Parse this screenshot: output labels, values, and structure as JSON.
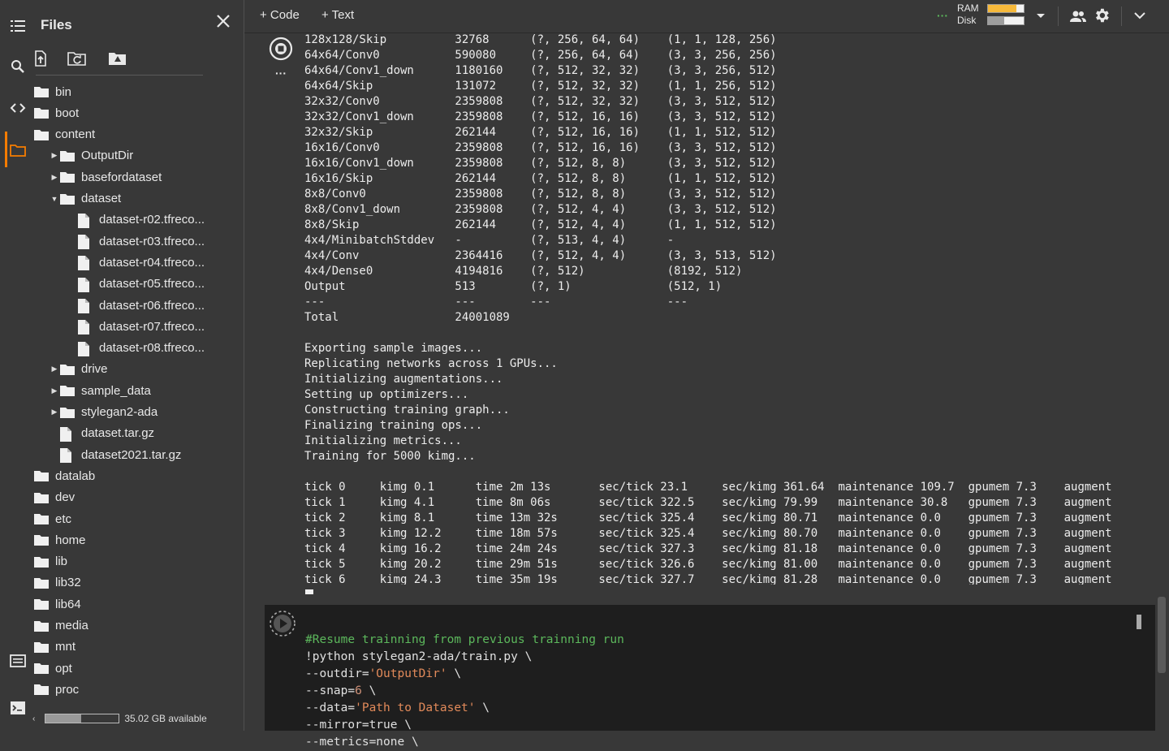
{
  "sidebar": {
    "title": "Files",
    "storage": "35.02 GB available",
    "tree": [
      {
        "label": "bin",
        "kind": "folder",
        "indent": 0,
        "arrow": ""
      },
      {
        "label": "boot",
        "kind": "folder",
        "indent": 0,
        "arrow": ""
      },
      {
        "label": "content",
        "kind": "folder",
        "indent": 0,
        "arrow": ""
      },
      {
        "label": "OutputDir",
        "kind": "folder",
        "indent": 1,
        "arrow": "right"
      },
      {
        "label": "basefordataset",
        "kind": "folder",
        "indent": 1,
        "arrow": "right"
      },
      {
        "label": "dataset",
        "kind": "folder",
        "indent": 1,
        "arrow": "down"
      },
      {
        "label": "dataset-r02.tfreco...",
        "kind": "file",
        "indent": 2,
        "arrow": ""
      },
      {
        "label": "dataset-r03.tfreco...",
        "kind": "file",
        "indent": 2,
        "arrow": ""
      },
      {
        "label": "dataset-r04.tfreco...",
        "kind": "file",
        "indent": 2,
        "arrow": ""
      },
      {
        "label": "dataset-r05.tfreco...",
        "kind": "file",
        "indent": 2,
        "arrow": ""
      },
      {
        "label": "dataset-r06.tfreco...",
        "kind": "file",
        "indent": 2,
        "arrow": ""
      },
      {
        "label": "dataset-r07.tfreco...",
        "kind": "file",
        "indent": 2,
        "arrow": ""
      },
      {
        "label": "dataset-r08.tfreco...",
        "kind": "file",
        "indent": 2,
        "arrow": ""
      },
      {
        "label": "drive",
        "kind": "folder",
        "indent": 1,
        "arrow": "right"
      },
      {
        "label": "sample_data",
        "kind": "folder",
        "indent": 1,
        "arrow": "right"
      },
      {
        "label": "stylegan2-ada",
        "kind": "folder",
        "indent": 1,
        "arrow": "right"
      },
      {
        "label": "dataset.tar.gz",
        "kind": "file",
        "indent": 1,
        "arrow": ""
      },
      {
        "label": "dataset2021.tar.gz",
        "kind": "file",
        "indent": 1,
        "arrow": ""
      },
      {
        "label": "datalab",
        "kind": "folder",
        "indent": 0,
        "arrow": ""
      },
      {
        "label": "dev",
        "kind": "folder",
        "indent": 0,
        "arrow": ""
      },
      {
        "label": "etc",
        "kind": "folder",
        "indent": 0,
        "arrow": ""
      },
      {
        "label": "home",
        "kind": "folder",
        "indent": 0,
        "arrow": ""
      },
      {
        "label": "lib",
        "kind": "folder",
        "indent": 0,
        "arrow": ""
      },
      {
        "label": "lib32",
        "kind": "folder",
        "indent": 0,
        "arrow": ""
      },
      {
        "label": "lib64",
        "kind": "folder",
        "indent": 0,
        "arrow": ""
      },
      {
        "label": "media",
        "kind": "folder",
        "indent": 0,
        "arrow": ""
      },
      {
        "label": "mnt",
        "kind": "folder",
        "indent": 0,
        "arrow": ""
      },
      {
        "label": "opt",
        "kind": "folder",
        "indent": 0,
        "arrow": ""
      },
      {
        "label": "proc",
        "kind": "folder",
        "indent": 0,
        "arrow": ""
      }
    ]
  },
  "toolbar": {
    "code_label": "+ Code",
    "text_label": "+ Text",
    "ram_label": "RAM",
    "disk_label": "Disk",
    "ram_fill": 0.8,
    "disk_fill": 0.45
  },
  "colors": {
    "accent": "#f57c00",
    "ram": "#f6b93b",
    "disk": "#9e9e9e",
    "comment": "#5cb85c",
    "string": "#e28a5a"
  },
  "output_lines": [
    "128x128/Skip          32768      (?, 256, 64, 64)    (1, 1, 128, 256)",
    "64x64/Conv0           590080     (?, 256, 64, 64)    (3, 3, 256, 256)",
    "64x64/Conv1_down      1180160    (?, 512, 32, 32)    (3, 3, 256, 512)",
    "64x64/Skip            131072     (?, 512, 32, 32)    (1, 1, 256, 512)",
    "32x32/Conv0           2359808    (?, 512, 32, 32)    (3, 3, 512, 512)",
    "32x32/Conv1_down      2359808    (?, 512, 16, 16)    (3, 3, 512, 512)",
    "32x32/Skip            262144     (?, 512, 16, 16)    (1, 1, 512, 512)",
    "16x16/Conv0           2359808    (?, 512, 16, 16)    (3, 3, 512, 512)",
    "16x16/Conv1_down      2359808    (?, 512, 8, 8)      (3, 3, 512, 512)",
    "16x16/Skip            262144     (?, 512, 8, 8)      (1, 1, 512, 512)",
    "8x8/Conv0             2359808    (?, 512, 8, 8)      (3, 3, 512, 512)",
    "8x8/Conv1_down        2359808    (?, 512, 4, 4)      (3, 3, 512, 512)",
    "8x8/Skip              262144     (?, 512, 4, 4)      (1, 1, 512, 512)",
    "4x4/MinibatchStddev   -          (?, 513, 4, 4)      -",
    "4x4/Conv              2364416    (?, 512, 4, 4)      (3, 3, 513, 512)",
    "4x4/Dense0            4194816    (?, 512)            (8192, 512)",
    "Output                513        (?, 1)              (512, 1)",
    "---                   ---        ---                 ---",
    "Total                 24001089",
    "",
    "Exporting sample images...",
    "Replicating networks across 1 GPUs...",
    "Initializing augmentations...",
    "Setting up optimizers...",
    "Constructing training graph...",
    "Finalizing training ops...",
    "Initializing metrics...",
    "Training for 5000 kimg...",
    "",
    "tick 0     kimg 0.1      time 2m 13s       sec/tick 23.1     sec/kimg 361.64  maintenance 109.7  gpumem 7.3    augment",
    "tick 1     kimg 4.1      time 8m 06s       sec/tick 322.5    sec/kimg 79.99   maintenance 30.8   gpumem 7.3    augment",
    "tick 2     kimg 8.1      time 13m 32s      sec/tick 325.4    sec/kimg 80.71   maintenance 0.0    gpumem 7.3    augment",
    "tick 3     kimg 12.2     time 18m 57s      sec/tick 325.4    sec/kimg 80.70   maintenance 0.0    gpumem 7.3    augment",
    "tick 4     kimg 16.2     time 24m 24s      sec/tick 327.3    sec/kimg 81.18   maintenance 0.0    gpumem 7.3    augment",
    "tick 5     kimg 20.2     time 29m 51s      sec/tick 326.6    sec/kimg 81.00   maintenance 0.0    gpumem 7.3    augment",
    "tick 6     kimg 24.3     time 35m 19s      sec/tick 327.7    sec/kimg 81.28   maintenance 0.0    gpumem 7.3    augment"
  ],
  "code_cell": {
    "comment": "#Resume trainning from previous trainning run",
    "l1": "!python stylegan2-ada/train.py \\",
    "l2a": "--outdir=",
    "l2s": "'OutputDir'",
    "l2b": " \\",
    "l3a": "--snap=",
    "l3n": "6",
    "l3b": " \\",
    "l4a": "--data=",
    "l4s": "'Path to Dataset'",
    "l4b": " \\",
    "l5": "--mirror=true \\",
    "l6": "--metrics=none \\"
  }
}
